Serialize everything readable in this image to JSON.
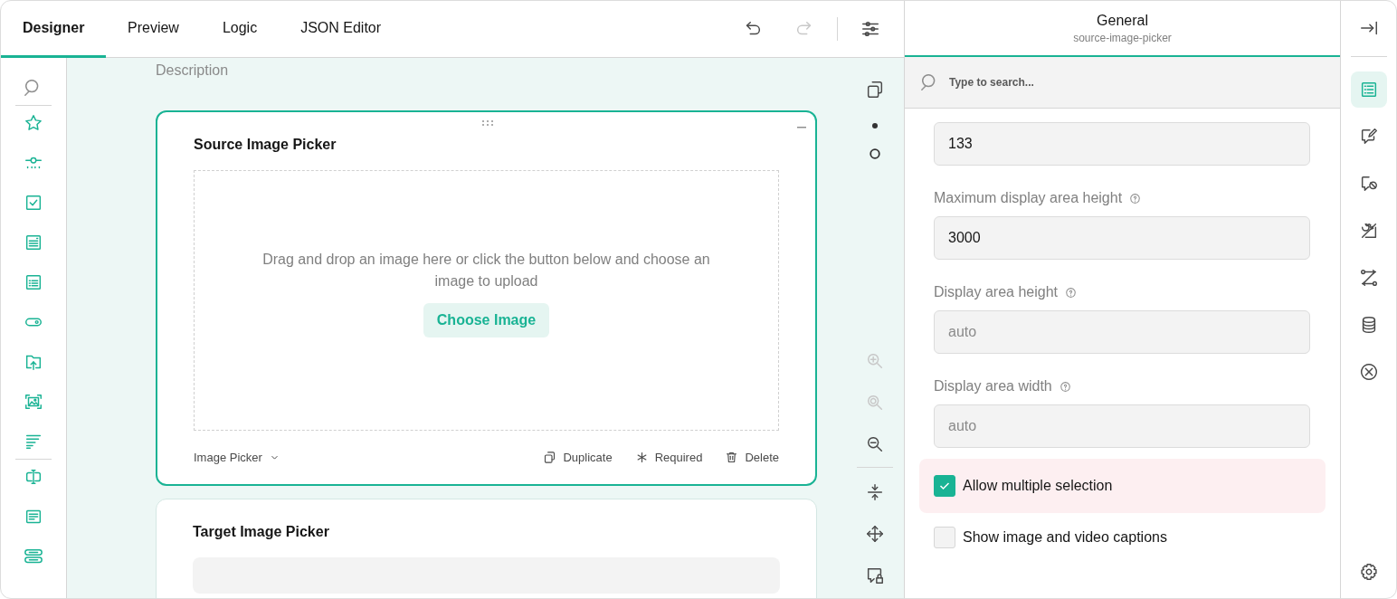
{
  "tabs": [
    {
      "label": "Designer",
      "selected": true
    },
    {
      "label": "Preview",
      "selected": false
    },
    {
      "label": "Logic",
      "selected": false
    },
    {
      "label": "JSON Editor",
      "selected": false
    }
  ],
  "history": {
    "undo_disabled": false,
    "redo_disabled": true
  },
  "canvas": {
    "description": "Description",
    "questions": [
      {
        "title": "Source Image Picker",
        "selected": true,
        "drop_text": "Drag and drop an image here or click the button below and choose an image to upload",
        "choose_button": "Choose Image",
        "type_label": "Image Picker",
        "actions": [
          {
            "kind": "duplicate",
            "label": "Duplicate"
          },
          {
            "kind": "required",
            "label": "Required"
          },
          {
            "kind": "delete",
            "label": "Delete"
          }
        ]
      },
      {
        "title": "Target Image Picker",
        "selected": false
      }
    ]
  },
  "zoom_tools": [
    {
      "kind": "zoom-in",
      "disabled": true
    },
    {
      "kind": "zoom-reset",
      "disabled": true
    },
    {
      "kind": "zoom-out",
      "disabled": false
    }
  ],
  "properties": {
    "title": "General",
    "subtitle": "source-image-picker",
    "search": {
      "placeholder": "Type to search..."
    },
    "fields": [
      {
        "value": "133"
      },
      {
        "label": "Maximum display area height",
        "value": "3000"
      },
      {
        "label": "Display area height",
        "placeholder": "auto"
      },
      {
        "label": "Display area width",
        "placeholder": "auto"
      }
    ],
    "checkboxes": [
      {
        "label": "Allow multiple selection",
        "checked": true,
        "highlighted": true
      },
      {
        "label": "Show image and video captions",
        "checked": false,
        "highlighted": false
      }
    ]
  },
  "rail": [
    {
      "selected": true
    },
    {
      "selected": false
    },
    {
      "selected": false
    },
    {
      "selected": false
    },
    {
      "selected": false
    },
    {
      "selected": false
    },
    {
      "selected": false
    }
  ]
}
